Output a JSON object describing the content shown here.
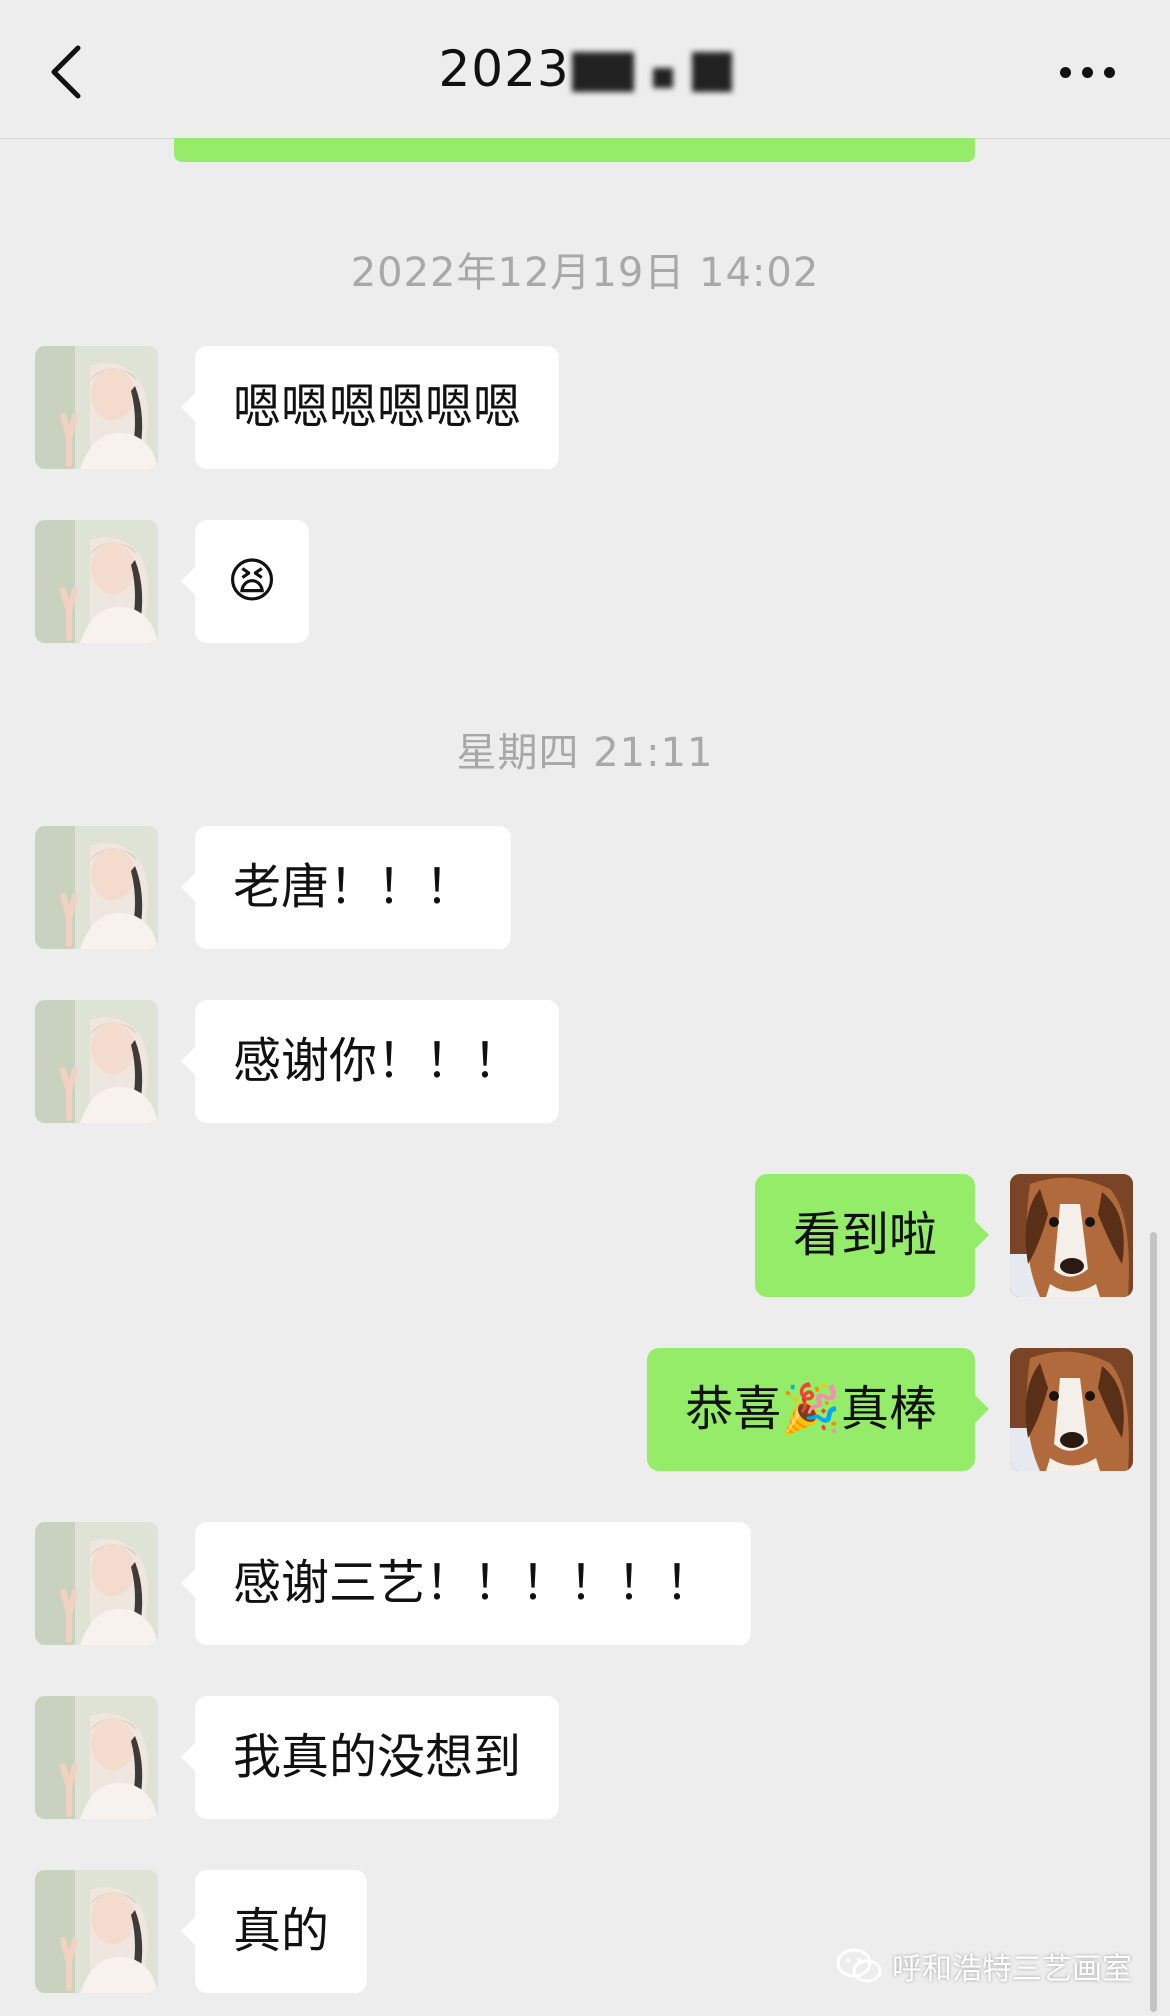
{
  "header": {
    "title": "2023",
    "back_icon": "chevron-left-icon",
    "more_icon": "more-dots-icon"
  },
  "timestamps": [
    "2022年12月19日 14:02",
    "星期四 21:11"
  ],
  "messages": [
    {
      "side": "left",
      "text": "嗯嗯嗯嗯嗯嗯"
    },
    {
      "side": "left",
      "text": "😫"
    },
    {
      "side": "left",
      "text": "老唐！！！"
    },
    {
      "side": "left",
      "text": "感谢你！！！"
    },
    {
      "side": "right",
      "text": "看到啦"
    },
    {
      "side": "right",
      "text": "恭喜🎉真棒"
    },
    {
      "side": "left",
      "text": "感谢三艺！！！！！！"
    },
    {
      "side": "left",
      "text": "我真的没想到"
    },
    {
      "side": "left",
      "text": "真的"
    }
  ],
  "watermark": {
    "text": "呼和浩特三艺画室",
    "icon": "wechat-logo-icon"
  },
  "colors": {
    "background": "#ededed",
    "bubble_self": "#95ec69",
    "bubble_other": "#ffffff",
    "timestamp": "#a8a8a8"
  }
}
